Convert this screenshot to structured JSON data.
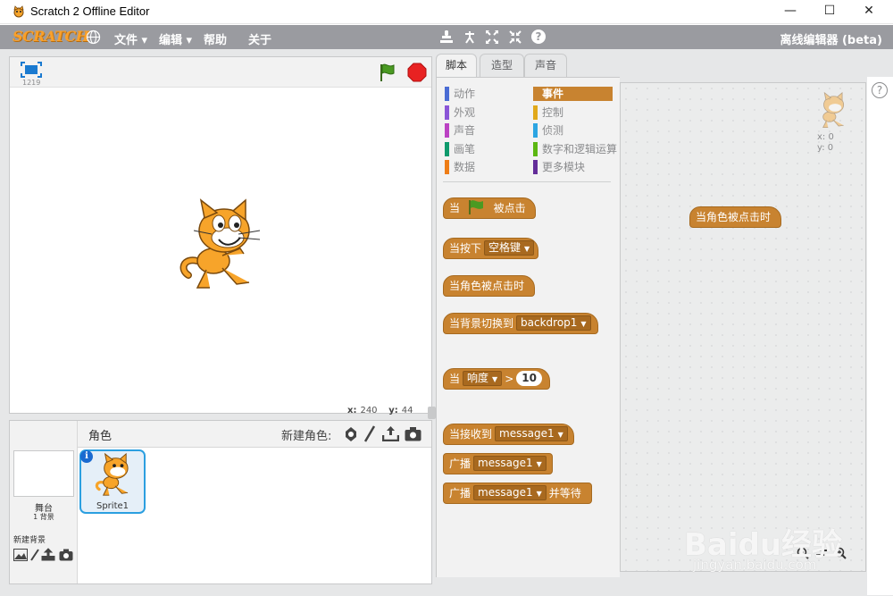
{
  "window": {
    "title": "Scratch 2 Offline Editor",
    "minimize": "—",
    "maximize": "☐",
    "close": "✕"
  },
  "menubar": {
    "logo": "SCRATCH",
    "items": [
      "文件",
      "编辑",
      "帮助",
      "关于"
    ],
    "edition": "离线编辑器 (beta)"
  },
  "stage": {
    "mode_label": "1219",
    "x_label": "x:",
    "x_value": "240",
    "y_label": "y:",
    "y_value": "44"
  },
  "sprites": {
    "header_label": "角色",
    "new_sprite_label": "新建角色:",
    "stage_label": "舞台",
    "stage_backdrops": "1 背景",
    "new_backdrop_label": "新建背景",
    "sprite_name": "Sprite1"
  },
  "tabs": [
    "脚本",
    "造型",
    "声音"
  ],
  "categories": {
    "left": [
      {
        "label": "动作",
        "color": "#4a6cd4"
      },
      {
        "label": "外观",
        "color": "#8a55d7"
      },
      {
        "label": "声音",
        "color": "#bb42c3"
      },
      {
        "label": "画笔",
        "color": "#0e9a6c"
      },
      {
        "label": "数据",
        "color": "#ee7d16"
      }
    ],
    "right": [
      {
        "label": "事件",
        "color": "#c88330"
      },
      {
        "label": "控制",
        "color": "#e1a91a"
      },
      {
        "label": "侦测",
        "color": "#2ca5e2"
      },
      {
        "label": "数字和逻辑运算",
        "color": "#5cb712"
      },
      {
        "label": "更多模块",
        "color": "#632d99"
      }
    ]
  },
  "blocks": {
    "flag_pre": "当",
    "flag_post": "被点击",
    "key_pre": "当按下",
    "key_value": "空格键",
    "sprite_clicked": "当角色被点击时",
    "backdrop_pre": "当背景切换到",
    "backdrop_value": "backdrop1",
    "sensor_pre": "当",
    "sensor_value": "响度",
    "sensor_op": ">",
    "sensor_num": "10",
    "receive_pre": "当接收到",
    "receive_value": "message1",
    "broadcast_pre": "广播",
    "broadcast_value": "message1",
    "broadcastwait_pre": "广播",
    "broadcastwait_value": "message1",
    "broadcastwait_post": "并等待"
  },
  "script_area": {
    "block_label": "当角色被点击时",
    "x_coord": "x: 0",
    "y_coord": "y: 0",
    "help": "?"
  },
  "watermark": {
    "brand": "Baidu经验",
    "url": "jingyan.baidu.com"
  },
  "colors": {
    "events": "#c88330",
    "menubar": "#9a9ba0"
  }
}
